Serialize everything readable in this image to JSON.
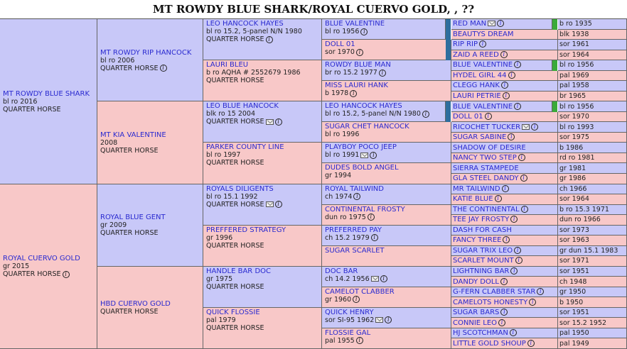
{
  "page": {
    "title": "MT ROWDY BLUE SHARK/ROYAL CUERVO GOLD, , ??"
  },
  "colors": {
    "sire": "#c8c8f8",
    "dam": "#f8c8c8",
    "link": "#2a2ad0",
    "marker_teal": "#2e6e9e",
    "marker_green": "#3aaa3a"
  },
  "icons": {
    "info": "info-icon",
    "video": "video-icon"
  },
  "gen1": [
    {
      "name": "MT ROWDY BLUE SHARK",
      "line1": "bl ro 2016",
      "line2": "QUARTER HORSE"
    },
    {
      "name": "ROYAL CUERVO GOLD",
      "line1": "gr 2015",
      "line2": "QUARTER HORSE"
    }
  ],
  "gen2": [
    {
      "name": "MT ROWDY RIP HANCOCK",
      "line1": "bl ro 2006",
      "line2": "QUARTER HORSE"
    },
    {
      "name": "MT KIA VALENTINE",
      "line1": "2008",
      "line2": "QUARTER HORSE"
    },
    {
      "name": "ROYAL BLUE GENT",
      "line1": "gr 2009",
      "line2": "QUARTER HORSE"
    },
    {
      "name": "HBD CUERVO GOLD",
      "line1": "",
      "line2": "QUARTER HORSE"
    }
  ],
  "gen3": [
    {
      "name": "LEO HANCOCK HAYES",
      "line1": "bl ro 15.2, 5-panel N/N 1980",
      "line2": "QUARTER HORSE"
    },
    {
      "name": "LAURI BLEU",
      "line1": "b ro AQHA # 2552679 1986",
      "line2": "QUARTER HORSE"
    },
    {
      "name": "LEO BLUE HANCOCK",
      "line1": "blk ro 15 2004",
      "line2": "QUARTER HORSE"
    },
    {
      "name": "PARKER COUNTY LINE",
      "line1": "bl ro 1997",
      "line2": "QUARTER HORSE"
    },
    {
      "name": "ROYALS DILIGENTS",
      "line1": "bl ro 15.1 1992",
      "line2": "QUARTER HORSE"
    },
    {
      "name": "PREFFERED STRATEGY",
      "line1": "gr 1996",
      "line2": "QUARTER HORSE"
    },
    {
      "name": "HANDLE BAR DOC",
      "line1": "gr 1975",
      "line2": "QUARTER HORSE"
    },
    {
      "name": "QUICK FLOSSIE",
      "line1": "pal 1979",
      "line2": "QUARTER HORSE"
    }
  ],
  "gen4": [
    {
      "name": "BLUE VALENTINE",
      "line1": "bl ro 1956"
    },
    {
      "name": "DOLL 01",
      "line1": "sor 1970"
    },
    {
      "name": "ROWDY BLUE MAN",
      "line1": "br ro 15.2 1977"
    },
    {
      "name": "MISS LAURI HANK",
      "line1": "b 1978"
    },
    {
      "name": "LEO HANCOCK HAYES",
      "line1": "bl ro 15.2, 5-panel N/N 1980"
    },
    {
      "name": "SUGAR CHET HANCOCK",
      "line1": "bl ro 1996"
    },
    {
      "name": "PLAYBOY POCO JEEP",
      "line1": "bl ro 1991"
    },
    {
      "name": "DUDES BOLD ANGEL",
      "line1": "gr 1994"
    },
    {
      "name": "ROYAL TAILWIND",
      "line1": "ch 1974"
    },
    {
      "name": "CONTINENTAL FROSTY",
      "line1": "dun ro 1975"
    },
    {
      "name": "PREFERRED PAY",
      "line1": "ch 15.2 1979"
    },
    {
      "name": "SUGAR SCARLET",
      "line1": ""
    },
    {
      "name": "DOC BAR",
      "line1": "ch 14.2 1956"
    },
    {
      "name": "CAMELOT CLABBER",
      "line1": "gr 1960"
    },
    {
      "name": "QUICK HENRY",
      "line1": "sor SI-95 1962"
    },
    {
      "name": "FLOSSIE GAL",
      "line1": "pal 1955"
    }
  ],
  "gen5": [
    {
      "name": "RED MAN",
      "record": "b ro 1935"
    },
    {
      "name": "BEAUTYS DREAM",
      "record": "blk 1938"
    },
    {
      "name": "RIP RIP",
      "record": "sor 1961"
    },
    {
      "name": "ZAID A REED",
      "record": "sor 1964"
    },
    {
      "name": "BLUE VALENTINE",
      "record": "bl ro 1956"
    },
    {
      "name": "HYDEL GIRL 44",
      "record": "pal 1969"
    },
    {
      "name": "CLEGG HANK",
      "record": "pal 1958"
    },
    {
      "name": "LAURI PETRIE",
      "record": "br 1965"
    },
    {
      "name": "BLUE VALENTINE",
      "record": "bl ro 1956"
    },
    {
      "name": "DOLL 01",
      "record": "sor 1970"
    },
    {
      "name": "RICOCHET TUCKER",
      "record": "bl ro 1993"
    },
    {
      "name": "SUGAR SABINE",
      "record": "sor 1975"
    },
    {
      "name": "SHADOW OF DESIRE",
      "record": "b 1986"
    },
    {
      "name": "NANCY TWO STEP",
      "record": "rd ro 1981"
    },
    {
      "name": "SIERRA STAMPEDE",
      "record": "gr 1981"
    },
    {
      "name": "GLA STEEL DANDY",
      "record": "gr 1986"
    },
    {
      "name": "MR TAILWIND",
      "record": "ch 1966"
    },
    {
      "name": "KATIE BLUE",
      "record": "sor 1964"
    },
    {
      "name": "THE CONTINENTAL",
      "record": "b ro 15.3 1971"
    },
    {
      "name": "TEE JAY FROSTY",
      "record": "dun ro 1966"
    },
    {
      "name": "DASH FOR CASH",
      "record": "sor 1973"
    },
    {
      "name": "FANCY THREE",
      "record": "sor 1963"
    },
    {
      "name": "SUGAR TRIX LEO",
      "record": "gr dun 15.1 1983"
    },
    {
      "name": "SCARLET MOUNT",
      "record": "sor 1971"
    },
    {
      "name": "LIGHTNING BAR",
      "record": "sor 1951"
    },
    {
      "name": "DANDY DOLL",
      "record": "ch 1948"
    },
    {
      "name": "G-FERN CLABBER STAR",
      "record": "gr 1950"
    },
    {
      "name": "CAMELOTS HONESTY",
      "record": "b 1950"
    },
    {
      "name": "SUGAR BARS",
      "record": "sor 1951"
    },
    {
      "name": "CONNIE LEO",
      "record": "sor 15.2 1952"
    },
    {
      "name": "HJ SCOTCHMAN",
      "record": "pal 1950"
    },
    {
      "name": "LITTLE GOLD SHOUP",
      "record": "pal 1949"
    }
  ]
}
